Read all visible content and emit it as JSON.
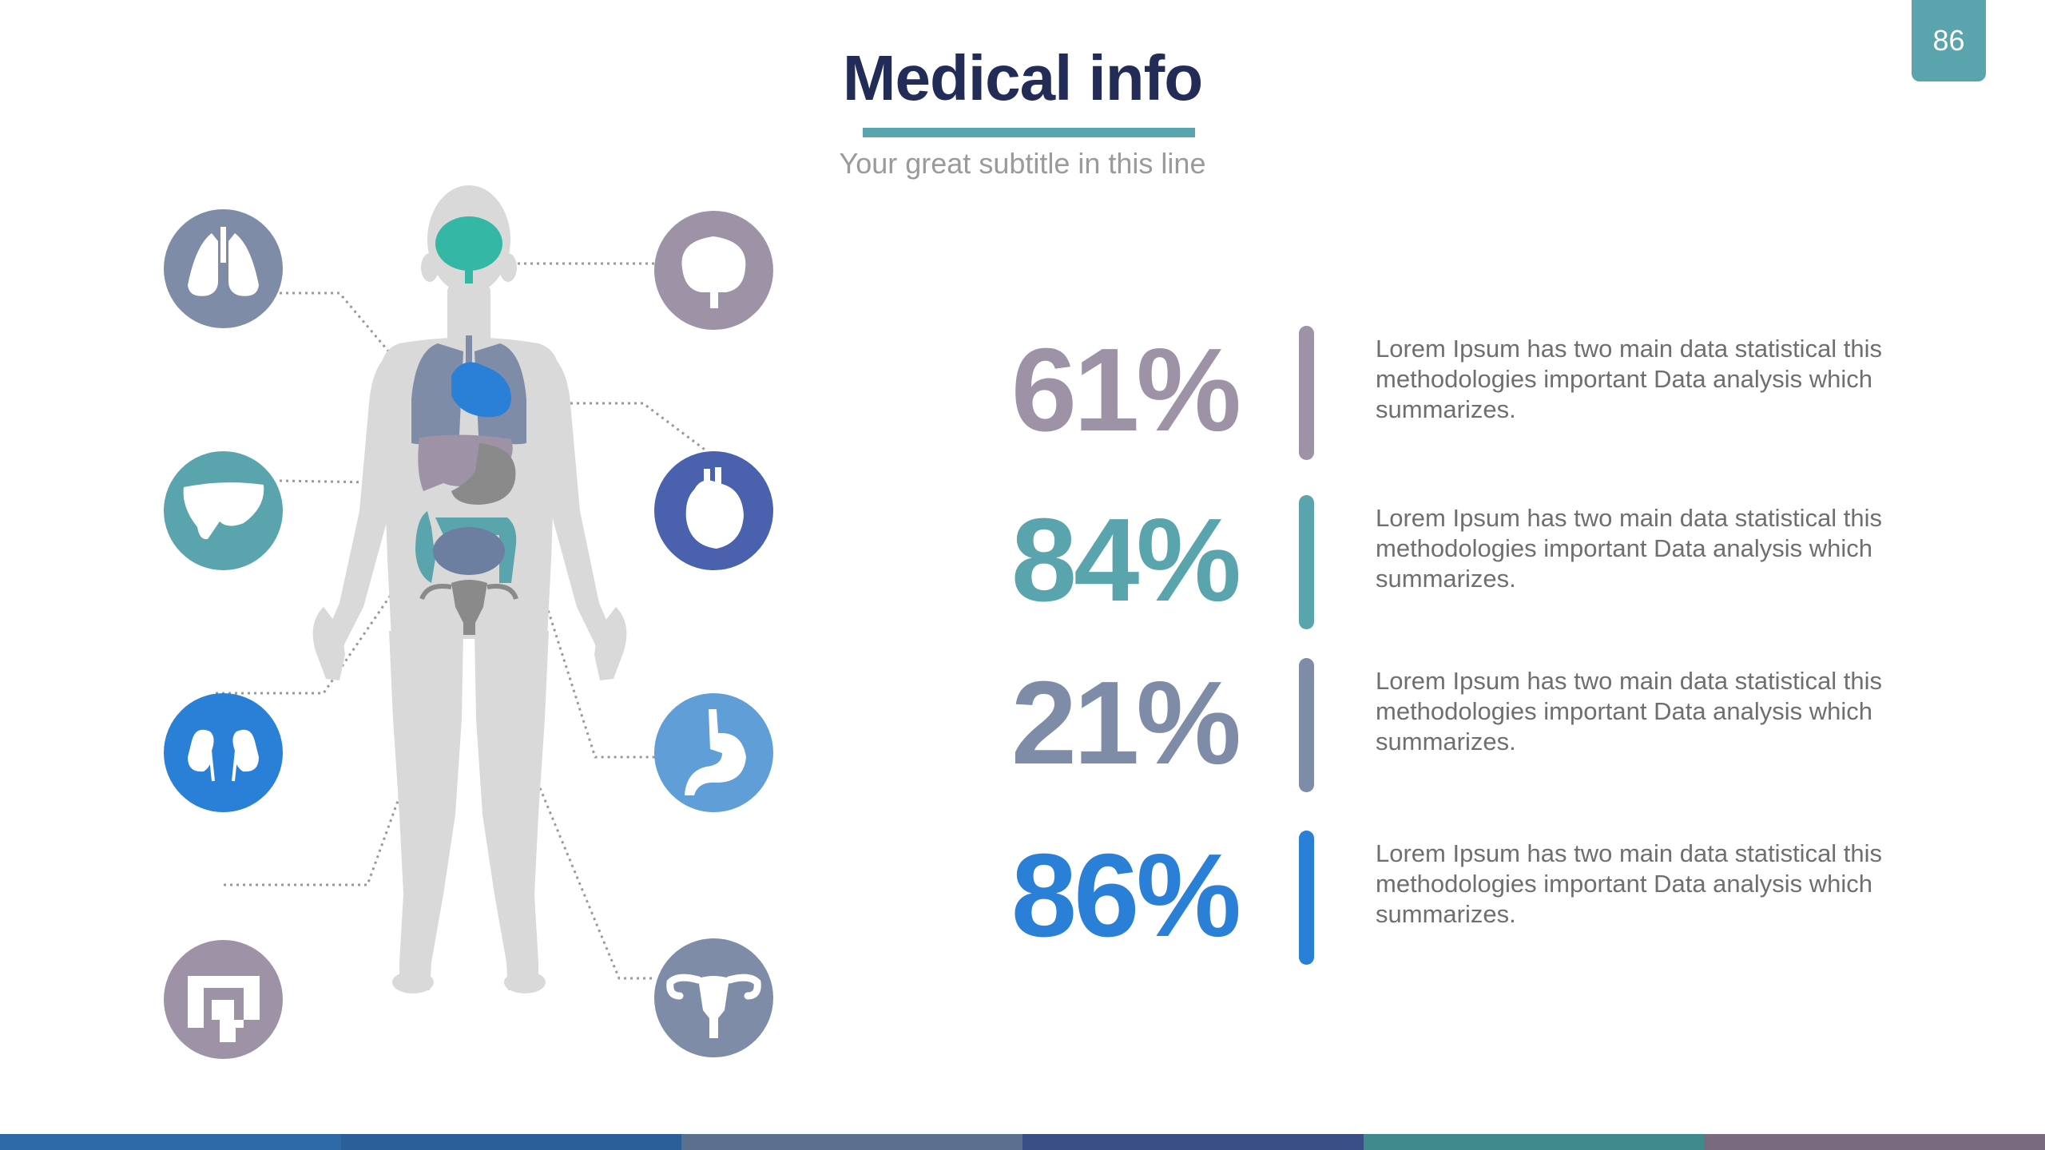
{
  "page": {
    "number": "86"
  },
  "header": {
    "title": "Medical info",
    "subtitle": "Your great subtitle in this line"
  },
  "colors": {
    "accent_teal": "#5aa5ad",
    "navy": "#232c57",
    "body_gray": "#d9d9d9",
    "mauve": "#9e92a6",
    "slate": "#7e8ca8",
    "blue": "#2a7fd6",
    "indigo": "#4a62ad",
    "light_blue": "#5f9ed6",
    "mint": "#35b7a5"
  },
  "organ_icons": [
    {
      "name": "lungs-icon",
      "color": "#7e8ca8"
    },
    {
      "name": "brain-icon",
      "color": "#9e92a6"
    },
    {
      "name": "liver-icon",
      "color": "#5aa5ad"
    },
    {
      "name": "heart-icon",
      "color": "#4a62ad"
    },
    {
      "name": "kidneys-icon",
      "color": "#2a7fd6"
    },
    {
      "name": "stomach-icon",
      "color": "#5f9ed6"
    },
    {
      "name": "intestines-icon",
      "color": "#9e92a6"
    },
    {
      "name": "uterus-icon",
      "color": "#7e8ca8"
    }
  ],
  "stats": [
    {
      "value": "61%",
      "color": "#9e92a6",
      "text": "Lorem Ipsum has two main data statistical this methodologies important Data analysis which summarizes."
    },
    {
      "value": "84%",
      "color": "#5aa5ad",
      "text": "Lorem Ipsum has two main data statistical this methodologies important Data analysis which summarizes."
    },
    {
      "value": "21%",
      "color": "#7e8ca8",
      "text": "Lorem Ipsum has two main data statistical this methodologies important Data analysis which summarizes."
    },
    {
      "value": "86%",
      "color": "#2a7fd6",
      "text": "Lorem Ipsum has two main data statistical this methodologies important Data analysis which summarizes."
    }
  ],
  "footer_strip": [
    "#2f6aa8",
    "#2a5f99",
    "#5b6f8e",
    "#3b4f87",
    "#3f8a8c",
    "#7a6a80"
  ]
}
